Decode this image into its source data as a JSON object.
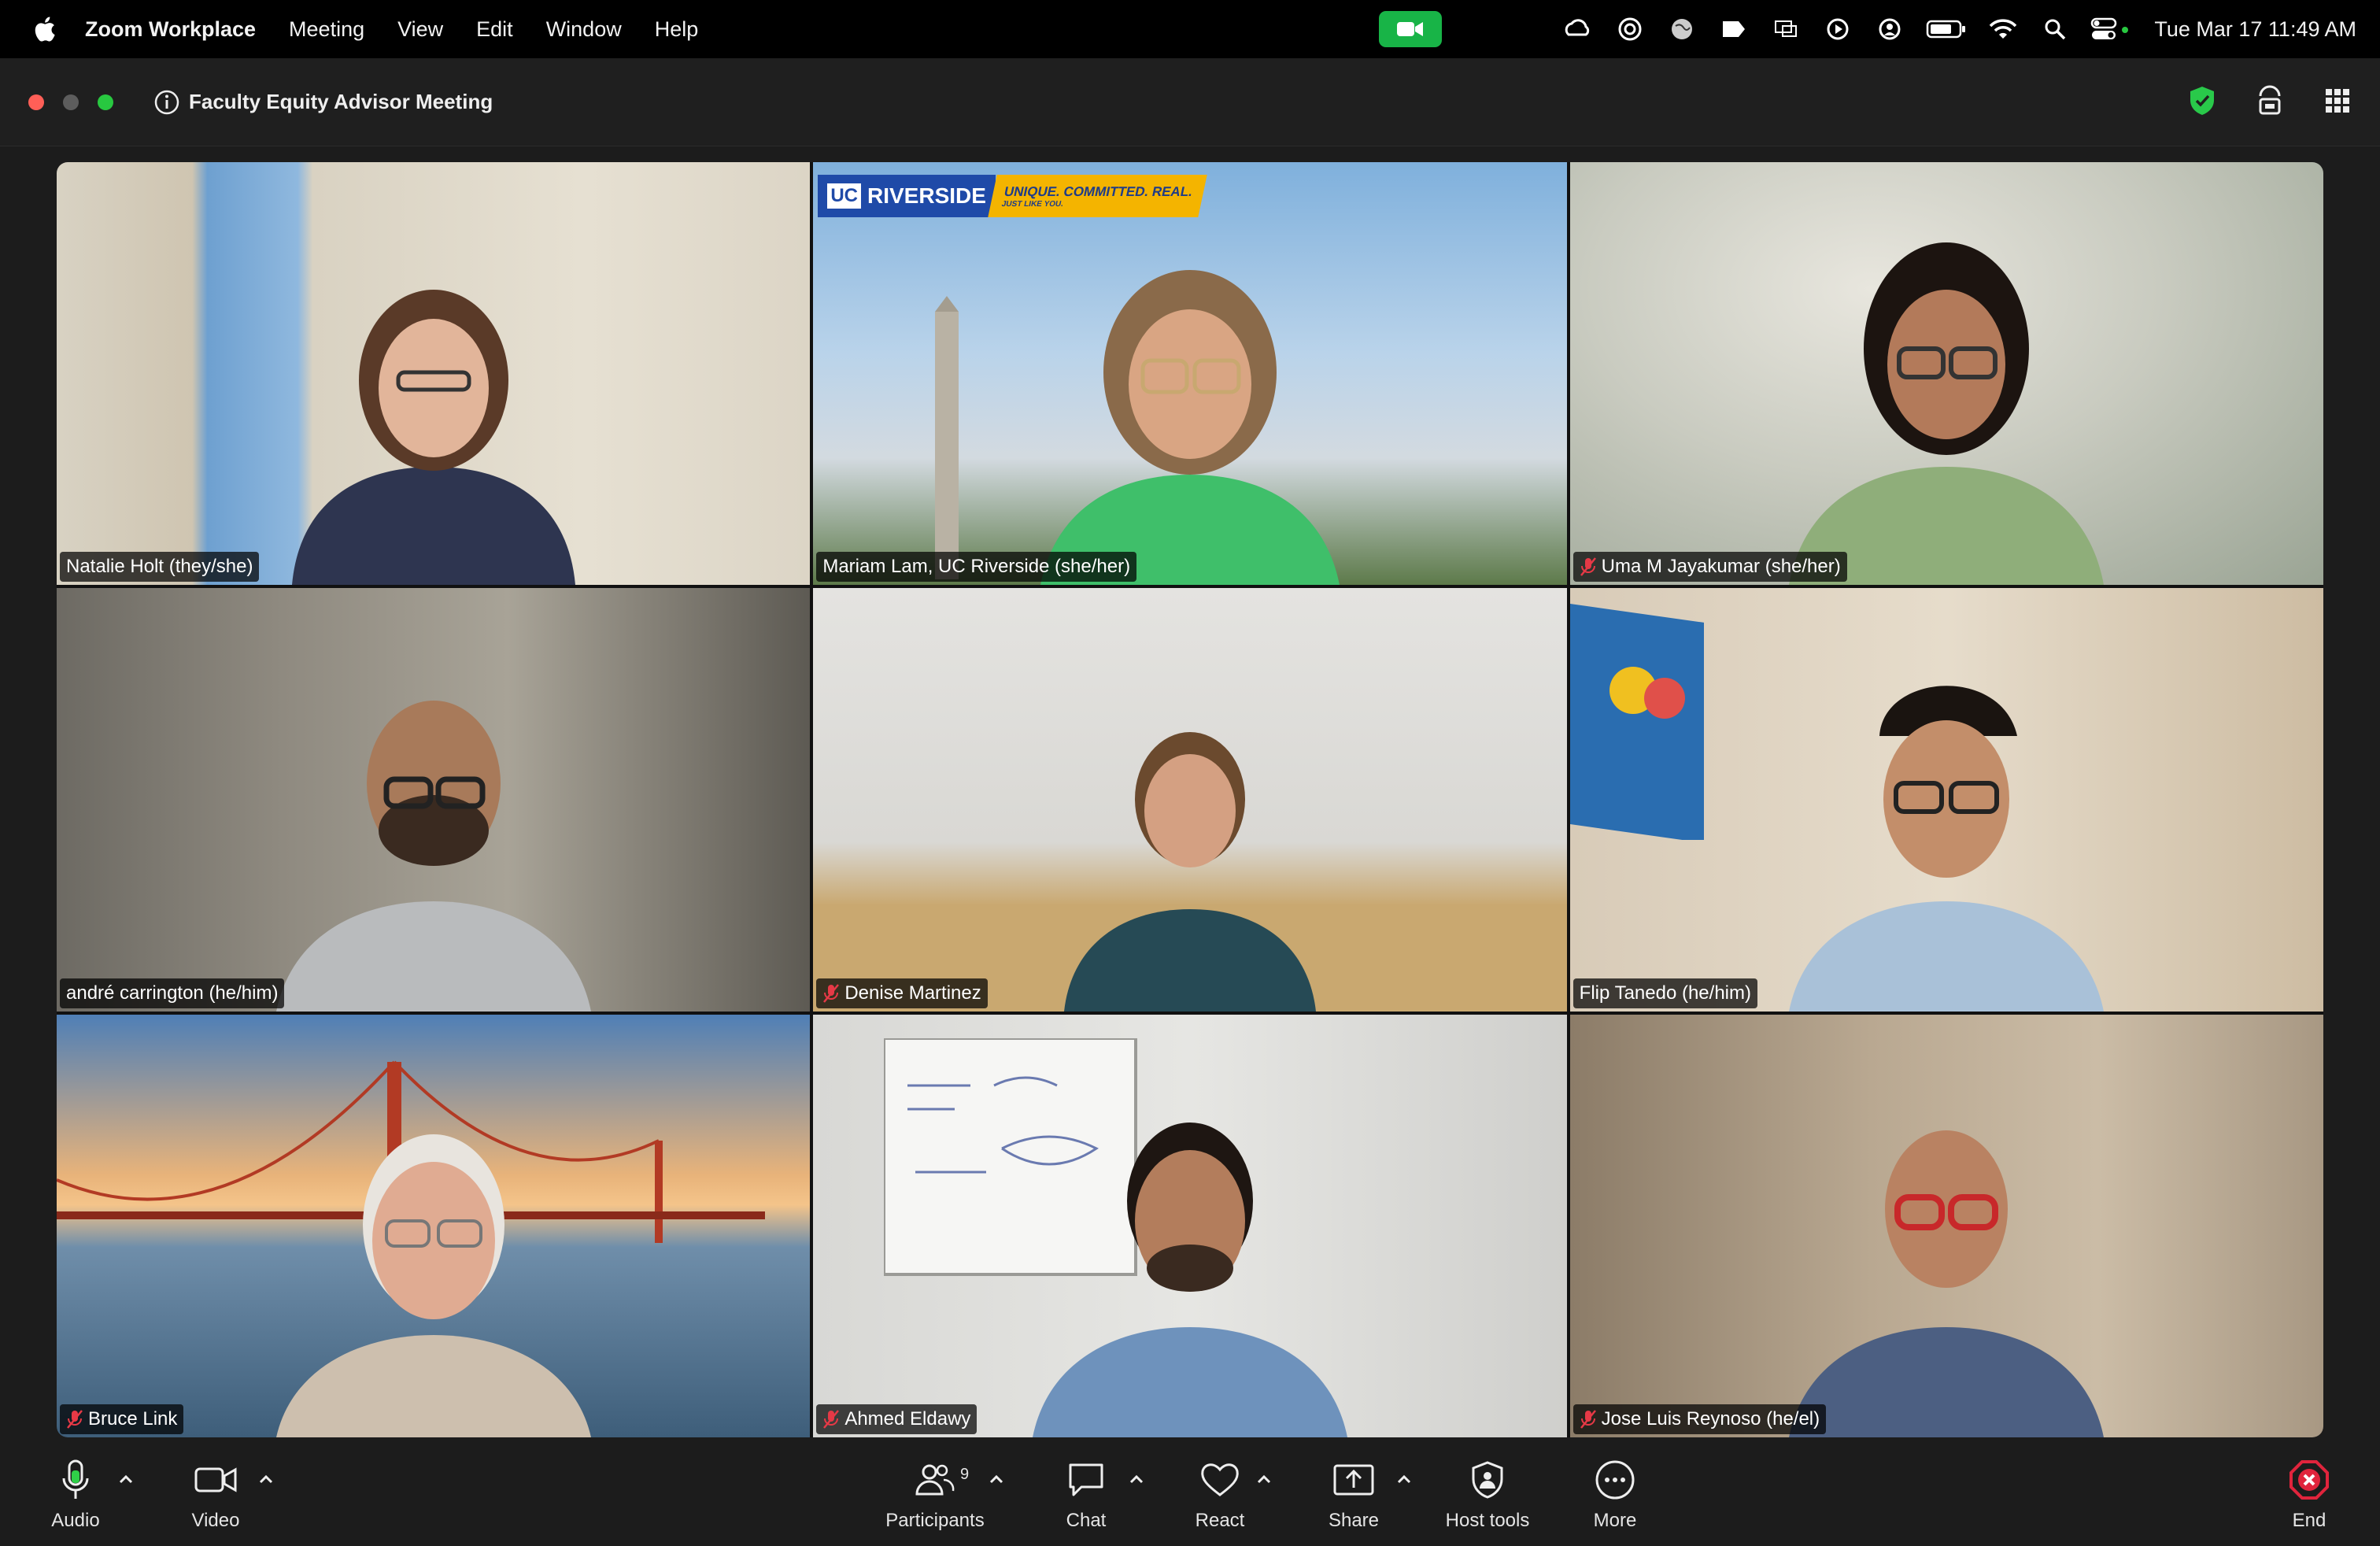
{
  "menubar": {
    "app_name": "Zoom Workplace",
    "items": [
      "Meeting",
      "View",
      "Edit",
      "Window",
      "Help"
    ],
    "datetime": "Tue Mar 17  11:49 AM",
    "tray_icons": [
      "creative-cloud-icon",
      "vpn-icon",
      "globe-icon",
      "notes-icon",
      "screen-mirror-icon",
      "play-icon",
      "user-icon",
      "battery-icon",
      "wifi-icon",
      "search-icon",
      "control-center-icon"
    ]
  },
  "window": {
    "title": "Faculty Equity Advisor Meeting",
    "right_icons": [
      "security-shield-icon",
      "speaker-view-icon",
      "gallery-grid-icon"
    ]
  },
  "tiles": [
    {
      "name": "Natalie Holt (they/she)",
      "muted": false,
      "speaking": false
    },
    {
      "name": "Mariam Lam, UC Riverside (she/her)",
      "muted": false,
      "speaking": true,
      "banner": {
        "uc": "UC",
        "campus": "RIVERSIDE",
        "tagline": "UNIQUE. COMMITTED. REAL.",
        "subtagline": "JUST LIKE YOU."
      }
    },
    {
      "name": "Uma M Jayakumar (she/her)",
      "muted": true,
      "speaking": false
    },
    {
      "name": "andré carrington (he/him)",
      "muted": false,
      "speaking": false
    },
    {
      "name": "Denise Martinez",
      "muted": true,
      "speaking": false
    },
    {
      "name": "Flip Tanedo (he/him)",
      "muted": false,
      "speaking": false
    },
    {
      "name": "Bruce Link",
      "muted": true,
      "speaking": false
    },
    {
      "name": "Ahmed Eldawy",
      "muted": true,
      "speaking": false
    },
    {
      "name": "Jose Luis Reynoso (he/el)",
      "muted": true,
      "speaking": false
    }
  ],
  "toolbar": {
    "audio": "Audio",
    "video": "Video",
    "participants": "Participants",
    "participants_count": "9",
    "chat": "Chat",
    "react": "React",
    "share": "Share",
    "host_tools": "Host tools",
    "more": "More",
    "end": "End"
  },
  "colors": {
    "active_speaker": "#2fd048",
    "end_button": "#e0243c",
    "zoom_indicator": "#18b447"
  }
}
